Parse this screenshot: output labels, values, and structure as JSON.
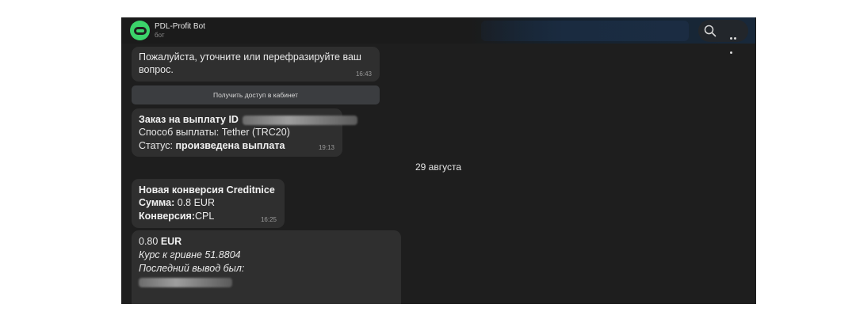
{
  "header": {
    "bot_name": "PDL-Profit Bot",
    "bot_subtitle": "бот",
    "avatar_color": "#3bd36a",
    "icons": [
      "search-icon",
      "more-icon"
    ]
  },
  "messages": {
    "m1": {
      "text": "Пожалуйста, уточните или перефразируйте ваш вопрос.",
      "time": "16:43"
    },
    "keyboard_button": "Получить доступ в кабинет",
    "m2": {
      "line1_bold": "Заказ на выплату ID",
      "line2": "Способ выплаты: Tether (TRC20)",
      "line3_prefix": "Статус: ",
      "line3_bold": "произведена выплата",
      "time": "19:13"
    },
    "date_separator": "29 августа",
    "m3": {
      "line1_bold": "Новая конверсия Creditnice",
      "line2_bold": "Сумма:",
      "line2_value": " 0.8 EUR",
      "line3_bold": "Конверсия:",
      "line3_value": "CPL",
      "time": "16:25"
    },
    "m4": {
      "line1_value": "0.80 ",
      "line1_bold": "EUR",
      "line2_italic": "Курс к гривне 51.8804",
      "line3_italic": "Последний вывод был:"
    }
  }
}
